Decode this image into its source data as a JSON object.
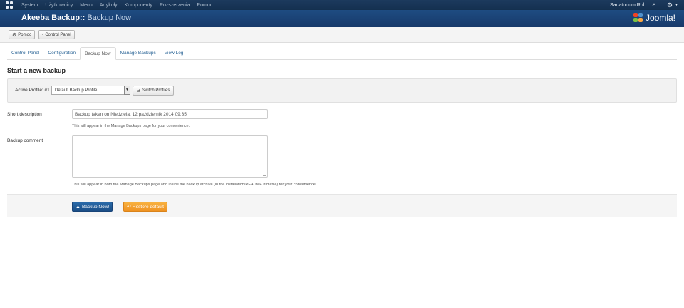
{
  "topbar": {
    "menu": [
      "System",
      "Użytkownicy",
      "Menu",
      "Artykuły",
      "Komponenty",
      "Rozszerzenia",
      "Pomoc"
    ],
    "site_name": "Sanatorium Rol...",
    "icons": [
      "joomla-icon",
      "external-link-icon",
      "gear-icon",
      "caret-down-icon"
    ]
  },
  "header": {
    "title_main": "Akeeba Backup::",
    "title_sub": " Backup Now",
    "brand": "Joomla!"
  },
  "toolbar": {
    "help_label": "Pomoc",
    "control_panel_label": "Control Panel"
  },
  "tabs": [
    {
      "label": "Control Panel"
    },
    {
      "label": "Configuration"
    },
    {
      "label": "Backup Now",
      "active": true
    },
    {
      "label": "Manage Backups"
    },
    {
      "label": "View Log"
    }
  ],
  "section_title": "Start a new backup",
  "profile": {
    "label": "Active Profile: #1",
    "selected": "Default Backup Profile",
    "switch_label": "Switch Profiles"
  },
  "form": {
    "short_description_label": "Short description",
    "short_description_value": "Backup taken on Niedziela, 12 październik 2014 09:35",
    "short_description_help": "This will appear in the Manage Backups page for your convenience.",
    "comment_label": "Backup comment",
    "comment_value": "",
    "comment_help": "This will appear in both the Manage Backups page and inside the backup archive (in the installation/README.html file) for your convenience."
  },
  "actions": {
    "backup_now_label": "Backup Now!",
    "restore_default_label": "Restore default"
  },
  "colors": {
    "topbar": "#14304f",
    "header": "#1e4c82",
    "primary_button": "#1b4e86",
    "warning_button": "#ef9222",
    "link": "#2a6496"
  }
}
